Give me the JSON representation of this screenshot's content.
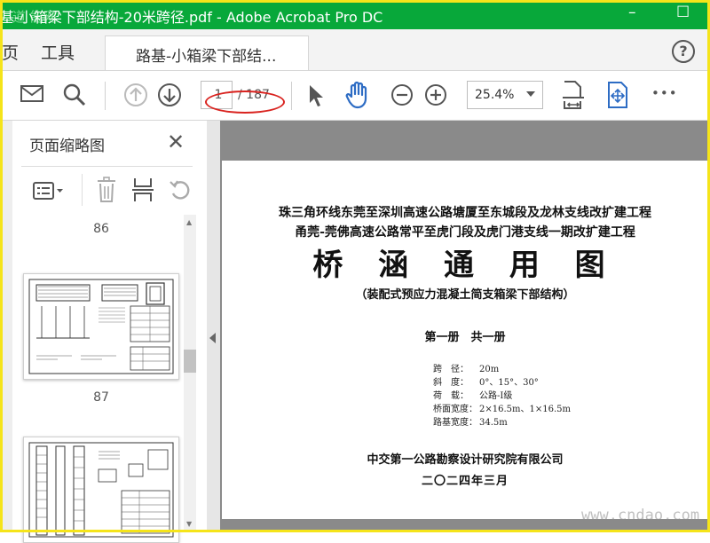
{
  "window": {
    "title": "基-小箱梁下部结构-20米跨径.pdf - Adobe Acrobat Pro DC",
    "title_watermark": "道 能网",
    "minimize": "–",
    "maximize": "☐"
  },
  "tabs": {
    "home_partial": "页",
    "tools": "工具",
    "document_tab": "路基-小箱梁下部结...",
    "help": "?"
  },
  "toolbar": {
    "page_current": "1",
    "page_total": "/ 187",
    "zoom": "25.4%",
    "more": "•••"
  },
  "sidebar": {
    "title": "页面缩略图",
    "close": "✕",
    "thumbnails": [
      {
        "page": "86"
      },
      {
        "page": "87"
      }
    ]
  },
  "document": {
    "line1": "珠三角环线东莞至深圳高速公路塘厦至东城段及龙林支线改扩建工程",
    "line2": "甬莞-莞佛高速公路常平至虎门段及虎门港支线一期改扩建工程",
    "big_title": "桥 涵 通 用 图",
    "subtitle": "（装配式预应力混凝土简支箱梁下部结构）",
    "volume": "第一册　共一册",
    "specs": [
      {
        "k": "跨　径：",
        "v": "20m"
      },
      {
        "k": "斜　度：",
        "v": "0°、15°、30°"
      },
      {
        "k": "荷　载：",
        "v": "公路-Ⅰ级"
      },
      {
        "k": "桥面宽度：",
        "v": "2×16.5m、1×16.5m"
      },
      {
        "k": "路基宽度：",
        "v": "34.5m"
      }
    ],
    "organization": "中交第一公路勘察设计研究院有限公司",
    "date": "二〇二四年三月"
  },
  "watermark": "www.cndao.com",
  "colors": {
    "titlebar": "#08a83a",
    "frame": "#f5e41a",
    "annotation": "#d9231f",
    "tool_blue": "#2d6cc4"
  }
}
